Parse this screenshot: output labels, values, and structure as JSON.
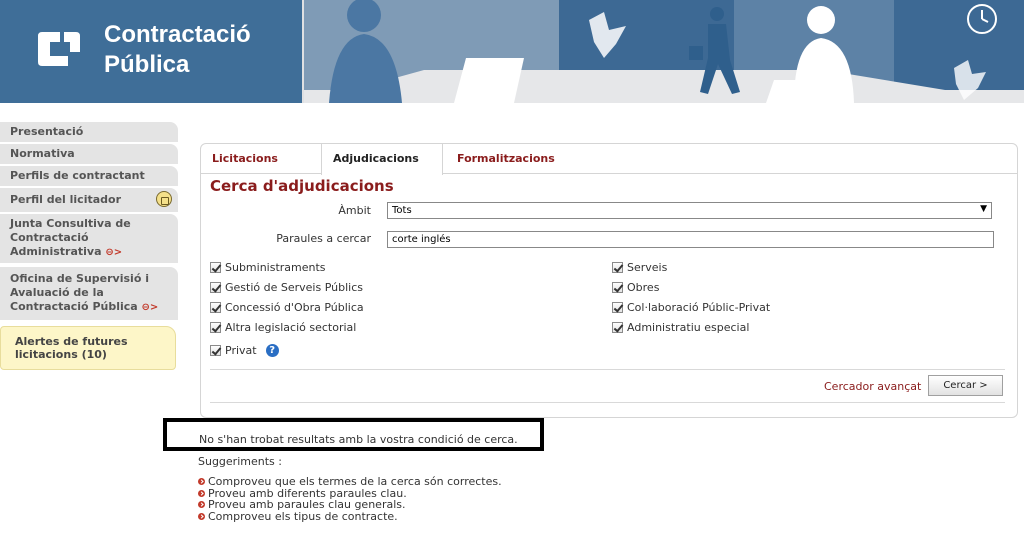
{
  "header": {
    "logo_line1": "Contractació",
    "logo_line2": "Pública"
  },
  "sidebar": {
    "items": [
      {
        "label": "Presentació"
      },
      {
        "label": "Normativa"
      },
      {
        "label": "Perfils de contractant"
      },
      {
        "label": "Perfil del licitador"
      },
      {
        "label": "Junta Consultiva de Contractació Administrativa"
      },
      {
        "label": "Oficina de Supervisió i Avaluació de la Contractació Pública"
      }
    ],
    "arrow": "⊖>",
    "alert": "Alertes de futures licitacions (10)"
  },
  "tabs": [
    "Licitacions",
    "Adjudicacions",
    "Formalitzacions"
  ],
  "form": {
    "title": "Cerca d'adjudicacions",
    "ambit_label": "Àmbit",
    "ambit_value": "Tots",
    "keywords_label": "Paraules a cercar",
    "keywords_value": "corte inglés",
    "checkboxes": [
      {
        "label": "Subministraments",
        "checked": true
      },
      {
        "label": "Serveis",
        "checked": true
      },
      {
        "label": "Gestió de Serveis Públics",
        "checked": true
      },
      {
        "label": "Obres",
        "checked": true
      },
      {
        "label": "Concessió d'Obra Pública",
        "checked": true
      },
      {
        "label": "Col·laboració Públic-Privat",
        "checked": true
      },
      {
        "label": "Altra legislació sectorial",
        "checked": true
      },
      {
        "label": "Administratiu especial",
        "checked": true
      },
      {
        "label": "Privat",
        "checked": true
      }
    ],
    "advanced_link": "Cercador avançat",
    "search_button": "Cercar >"
  },
  "results": {
    "message": "No s'han trobat resultats amb la vostra condició de cerca.",
    "suggestions_title": "Suggeriments :",
    "suggestions": [
      "Comproveu que els termes de la cerca són correctes.",
      "Proveu amb diferents paraules clau.",
      "Proveu amb paraules clau generals.",
      "Comproveu els tipus de contracte."
    ]
  },
  "colors": {
    "brand_blue": "#3f6e98",
    "accent_red": "#8a1c1c"
  }
}
